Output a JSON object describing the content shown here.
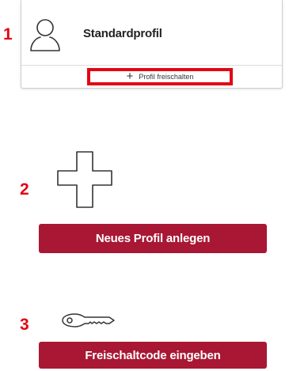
{
  "steps": [
    "1",
    "2",
    "3"
  ],
  "profile_card": {
    "name": "Standardprofil",
    "avatar_icon": "user-icon",
    "unlock_icon": "plus-icon",
    "unlock_label": "Profil freischalten",
    "highlight_color": "#e30613"
  },
  "new_profile": {
    "icon": "plus-icon",
    "button_label": "Neues Profil anlegen"
  },
  "unlock_code": {
    "icon": "key-icon",
    "button_label": "Freischaltcode eingeben"
  },
  "colors": {
    "step_number": "#e30613",
    "button_background": "#a81733",
    "button_text": "#ffffff"
  }
}
